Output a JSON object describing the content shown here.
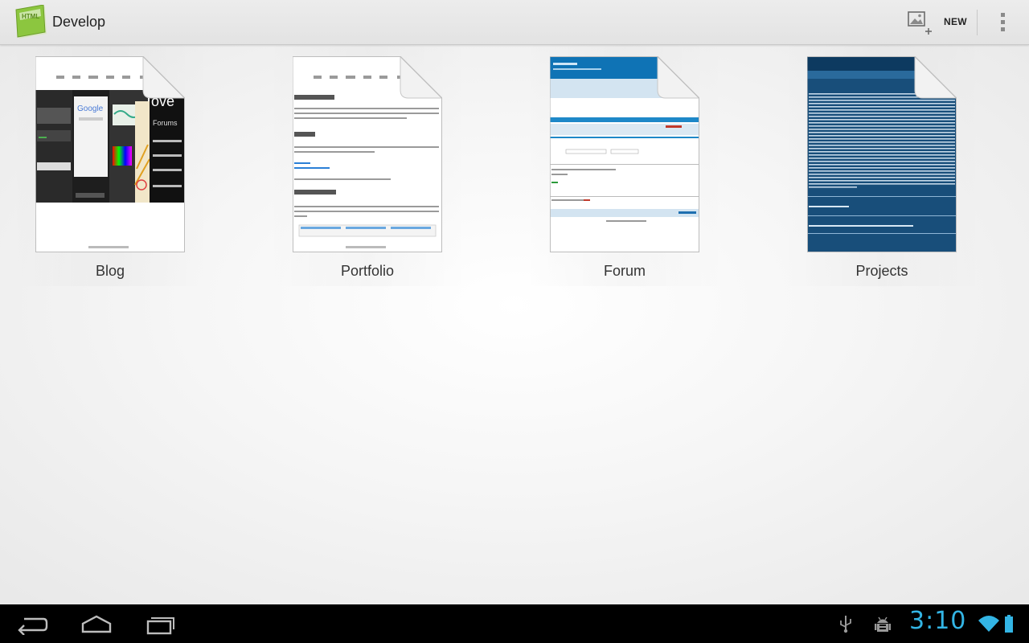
{
  "actionbar": {
    "title": "Develop",
    "new_label": "NEW"
  },
  "projects": [
    {
      "name": "Blog"
    },
    {
      "name": "Portfolio"
    },
    {
      "name": "Forum"
    },
    {
      "name": "Projects"
    }
  ],
  "statusbar": {
    "time": "3:10"
  },
  "colors": {
    "accent": "#33b5e5",
    "app_icon_green": "#8cc63f",
    "forum_blue": "#0f73b5",
    "projects_navy": "#184e7a"
  }
}
